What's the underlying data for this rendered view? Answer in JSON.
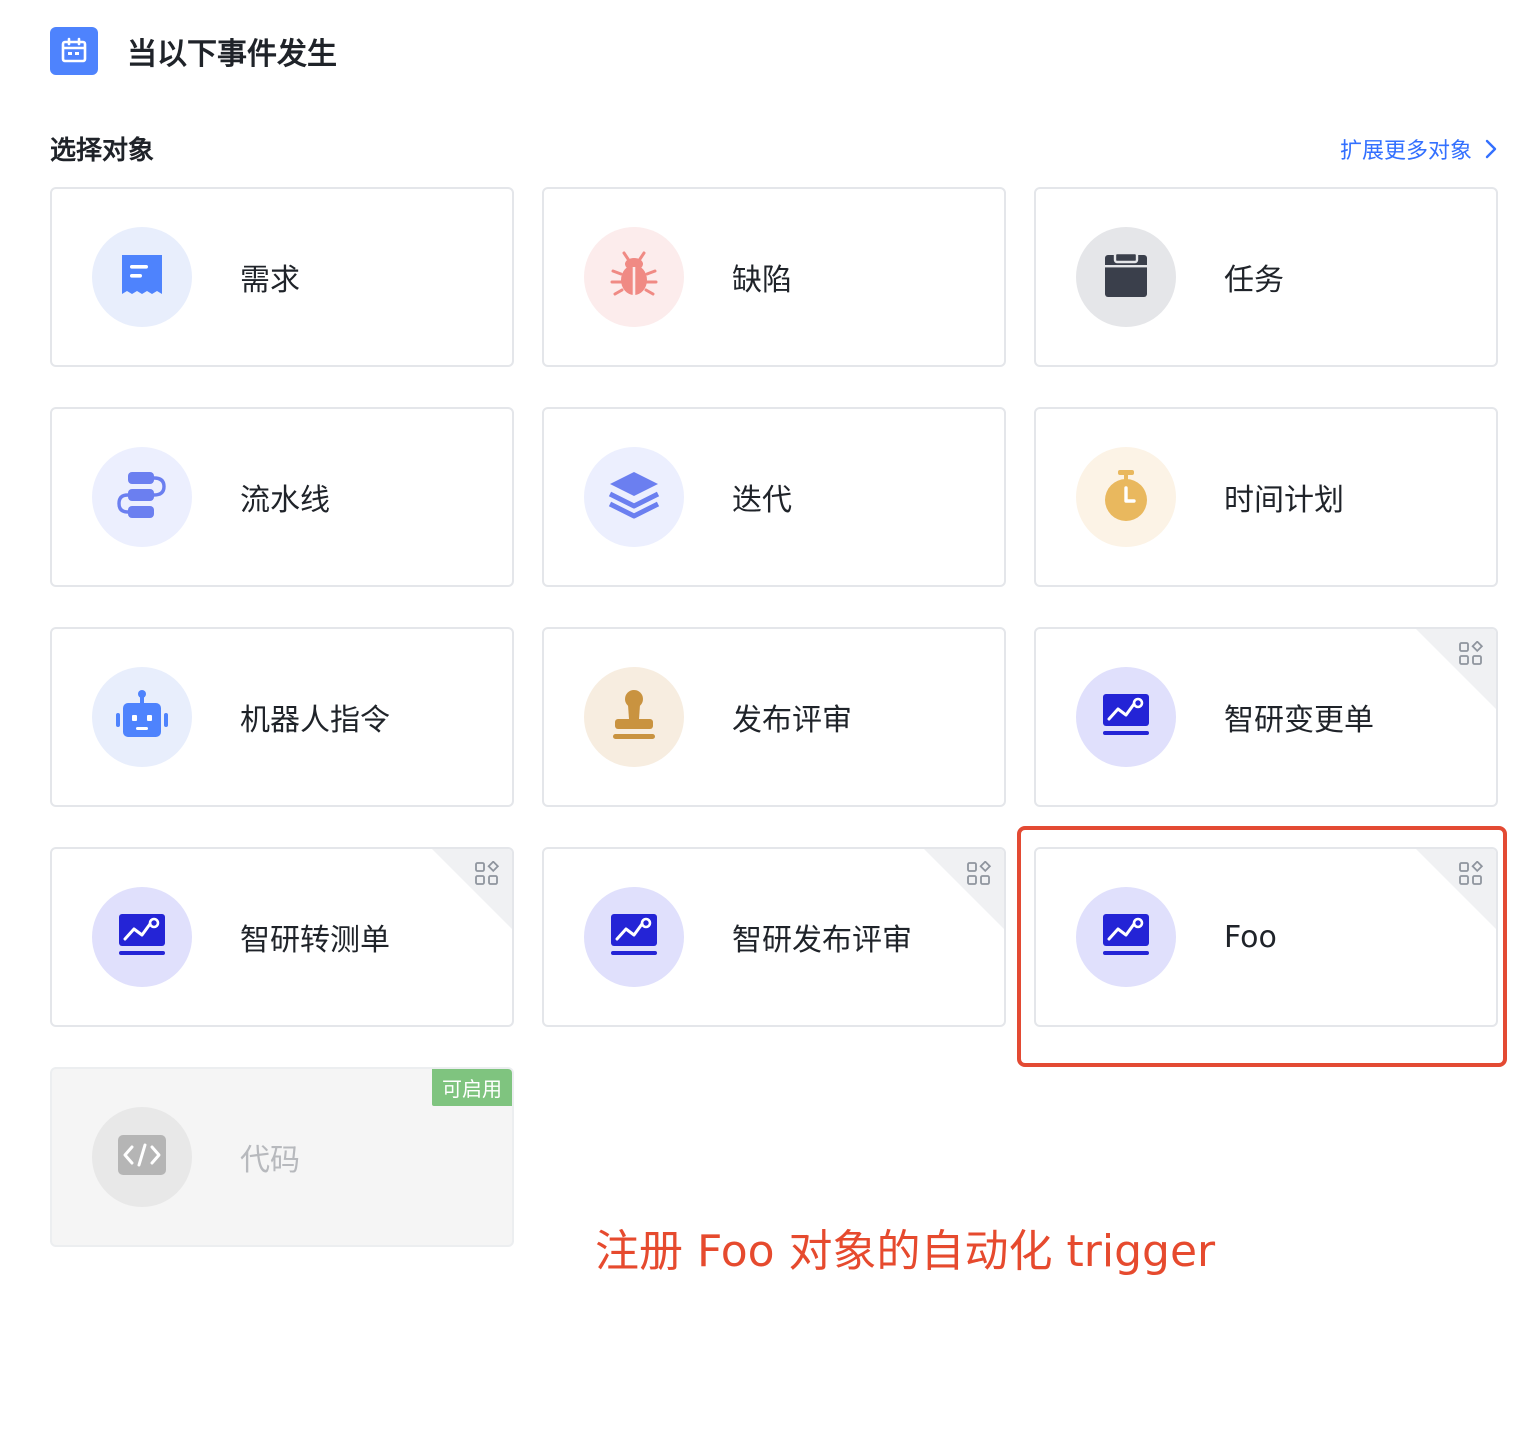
{
  "header": {
    "title": "当以下事件发生",
    "icon": "calendar-icon"
  },
  "section": {
    "label": "选择对象",
    "more_link": "扩展更多对象"
  },
  "cards": [
    {
      "label": "需求",
      "icon": "document-icon",
      "bg": "#e8eefc",
      "color": "#4e83fd"
    },
    {
      "label": "缺陷",
      "icon": "bug-icon",
      "bg": "#fcecec",
      "color": "#f08a84"
    },
    {
      "label": "任务",
      "icon": "task-icon",
      "bg": "#e5e6e9",
      "color": "#3a3f4b"
    },
    {
      "label": "流水线",
      "icon": "pipeline-icon",
      "bg": "#eceffe",
      "color": "#6b7ff0"
    },
    {
      "label": "迭代",
      "icon": "layers-icon",
      "bg": "#eceffe",
      "color": "#6b7ff0"
    },
    {
      "label": "时间计划",
      "icon": "timer-icon",
      "bg": "#fcf3e6",
      "color": "#e9b85e"
    },
    {
      "label": "机器人指令",
      "icon": "robot-icon",
      "bg": "#e8eefc",
      "color": "#4e83fd"
    },
    {
      "label": "发布评审",
      "icon": "stamp-icon",
      "bg": "#f7ede0",
      "color": "#c99340"
    },
    {
      "label": "智研变更单",
      "icon": "chart-board-icon",
      "bg": "#e0e0fc",
      "color": "#2424d6",
      "corner": "apps-icon"
    },
    {
      "label": "智研转测单",
      "icon": "chart-board-icon",
      "bg": "#e0e0fc",
      "color": "#2424d6",
      "corner": "apps-icon"
    },
    {
      "label": "智研发布评审",
      "icon": "chart-board-icon",
      "bg": "#e0e0fc",
      "color": "#2424d6",
      "corner": "apps-icon"
    },
    {
      "label": "Foo",
      "icon": "chart-board-icon",
      "bg": "#e0e0fc",
      "color": "#2424d6",
      "corner": "apps-icon"
    },
    {
      "label": "代码",
      "icon": "code-icon",
      "bg": "#e8e8e8",
      "color": "#b5b5b5",
      "badge": "可启用",
      "disabled": true
    }
  ],
  "annotation": {
    "text": "注册 Foo 对象的自动化 trigger",
    "color": "#e64a2e"
  }
}
